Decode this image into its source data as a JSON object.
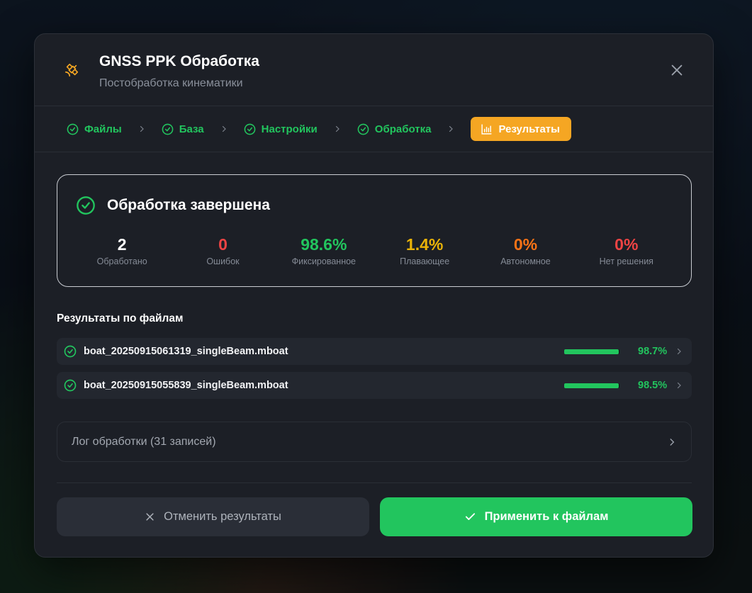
{
  "header": {
    "title": "GNSS PPK Обработка",
    "subtitle": "Постобработка кинематики",
    "icon": "satellite-icon"
  },
  "steps": [
    {
      "label": "Файлы",
      "state": "done"
    },
    {
      "label": "База",
      "state": "done"
    },
    {
      "label": "Настройки",
      "state": "done"
    },
    {
      "label": "Обработка",
      "state": "done"
    },
    {
      "label": "Результаты",
      "state": "active"
    }
  ],
  "summary": {
    "title": "Обработка завершена",
    "stats": [
      {
        "value": "2",
        "label": "Обработано",
        "color": "#ffffff"
      },
      {
        "value": "0",
        "label": "Ошибок",
        "color": "#ef4444"
      },
      {
        "value": "98.6%",
        "label": "Фиксированное",
        "color": "#22c55e"
      },
      {
        "value": "1.4%",
        "label": "Плавающее",
        "color": "#eab308"
      },
      {
        "value": "0%",
        "label": "Автономное",
        "color": "#f97316"
      },
      {
        "value": "0%",
        "label": "Нет решения",
        "color": "#ef4444"
      }
    ]
  },
  "files": {
    "title": "Результаты по файлам",
    "items": [
      {
        "name": "boat_20250915061319_singleBeam.mboat",
        "percent": "98.7%",
        "fill": 0.987
      },
      {
        "name": "boat_20250915055839_singleBeam.mboat",
        "percent": "98.5%",
        "fill": 0.985
      }
    ]
  },
  "log": {
    "label": "Лог обработки (31 записей)"
  },
  "actions": {
    "cancel_label": "Отменить результаты",
    "apply_label": "Применить к файлам"
  },
  "colors": {
    "accent": "#f5a623",
    "success": "#22c55e"
  }
}
